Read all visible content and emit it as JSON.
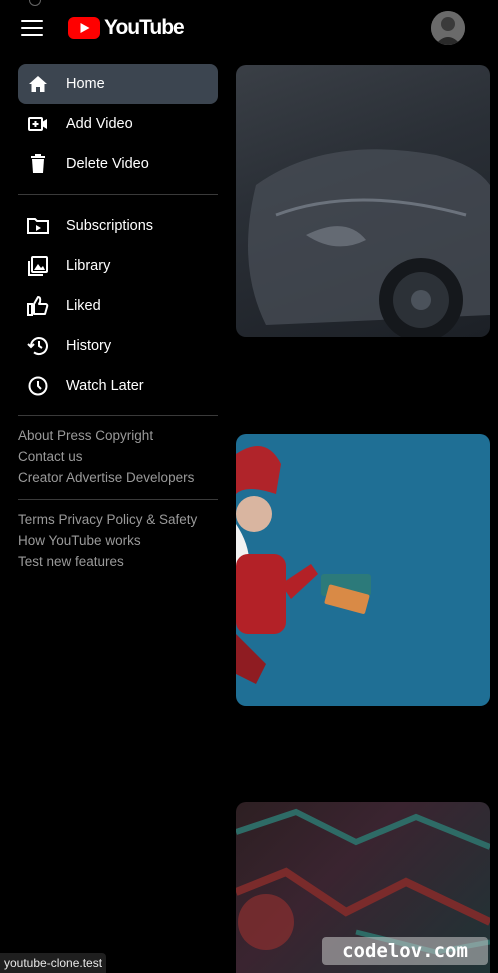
{
  "header": {
    "brand_name": "YouTube",
    "brand_color": "#ff0000"
  },
  "sidebar": {
    "primary": [
      {
        "label": "Home",
        "icon": "home-icon",
        "active": true
      },
      {
        "label": "Add Video",
        "icon": "add-video-icon",
        "active": false
      },
      {
        "label": "Delete Video",
        "icon": "trash-icon",
        "active": false
      }
    ],
    "secondary": [
      {
        "label": "Subscriptions",
        "icon": "subscriptions-icon"
      },
      {
        "label": "Library",
        "icon": "library-icon"
      },
      {
        "label": "Liked",
        "icon": "thumbs-up-icon"
      },
      {
        "label": "History",
        "icon": "history-icon"
      },
      {
        "label": "Watch Later",
        "icon": "clock-icon"
      }
    ],
    "footer_group1": [
      "About Press Copyright",
      "Contact us",
      "Creator Advertise Developers"
    ],
    "footer_group2": [
      "Terms Privacy Policy & Safety",
      "How YouTube works",
      "Test new features"
    ]
  },
  "overlays": {
    "status_url": "youtube-clone.test",
    "watermark": "codelov.com"
  },
  "colors": {
    "background": "#000000",
    "active_item": "#3c4550",
    "muted_text": "#9a9a9a"
  }
}
